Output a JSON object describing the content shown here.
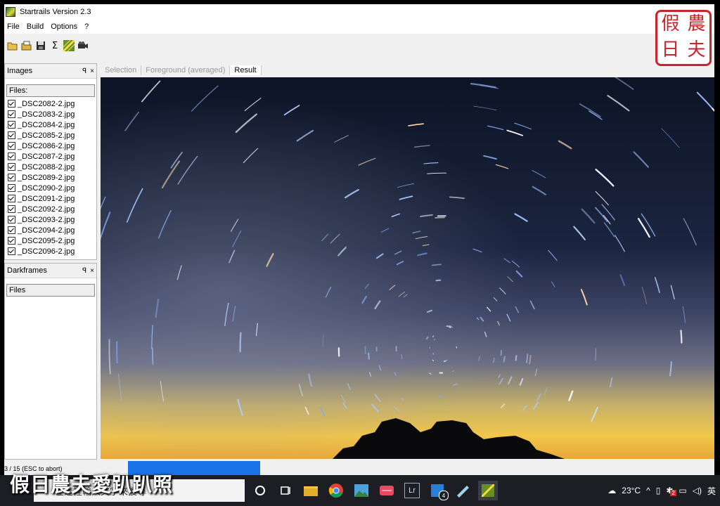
{
  "window": {
    "title": "Startrails Version 2.3"
  },
  "menu": [
    "File",
    "Build",
    "Options",
    "?"
  ],
  "toolbar": [
    "open-folder-icon",
    "open-files-icon",
    "save-icon",
    "sum-icon",
    "startrails-icon",
    "video-icon"
  ],
  "images_panel": {
    "title": "Images",
    "pin": "ꟼ",
    "close": "×",
    "files_label": "Files:",
    "files": [
      "_DSC2082-2.jpg",
      "_DSC2083-2.jpg",
      "_DSC2084-2.jpg",
      "_DSC2085-2.jpg",
      "_DSC2086-2.jpg",
      "_DSC2087-2.jpg",
      "_DSC2088-2.jpg",
      "_DSC2089-2.jpg",
      "_DSC2090-2.jpg",
      "_DSC2091-2.jpg",
      "_DSC2092-2.jpg",
      "_DSC2093-2.jpg",
      "_DSC2094-2.jpg",
      "_DSC2095-2.jpg",
      "_DSC2096-2.jpg"
    ]
  },
  "darkframes_panel": {
    "title": "Darkframes",
    "pin": "ꟼ",
    "close": "×",
    "files_label": "Files"
  },
  "tabs": [
    {
      "label": "Selection",
      "active": false
    },
    {
      "label": "Foreground (averaged)",
      "active": false
    },
    {
      "label": "Result",
      "active": true
    }
  ],
  "status": {
    "text": "3 / 15     (ESC to abort)",
    "progress": 0.2,
    "progress_color": "#1a73e8"
  },
  "taskbar": {
    "search_placeholder": "在這裡輸入文字來搜尋",
    "weather": "23°C",
    "ime": "英",
    "apps": [
      "task-view-icon",
      "file-explorer-icon",
      "chrome-icon",
      "photos-icon",
      "app-red-icon",
      "lightroom-icon",
      "app-blue-icon",
      "app-pen-icon",
      "startrails-task-icon"
    ],
    "lightroom_label": "Lr",
    "badge_count": "4",
    "tray_badge": "2"
  },
  "watermark": {
    "bottom_text": "假日農夫愛趴趴照",
    "seal_chars": [
      "農",
      "假",
      "夫",
      "日"
    ]
  },
  "colors": {
    "seal_red": "#c8262b",
    "taskbar_bg": "#1c1e24",
    "accent_blue": "#1a73e8"
  }
}
